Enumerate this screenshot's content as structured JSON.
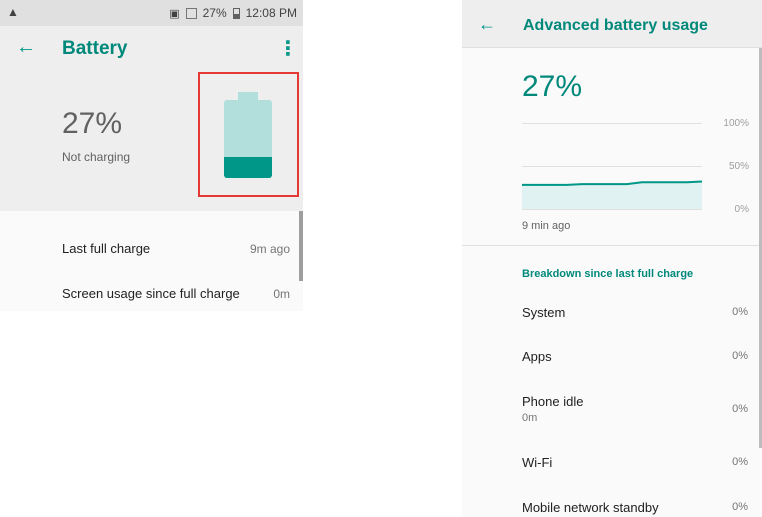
{
  "left_screen": {
    "status_bar": {
      "battery_percent": "27%",
      "time": "12:08 PM"
    },
    "app_bar": {
      "title": "Battery",
      "icons": [
        "back-arrow-icon",
        "more-vert-icon"
      ]
    },
    "summary": {
      "percent": "27%",
      "state": "Not charging",
      "battery_level_fraction": 0.27,
      "accent_color": "#009688",
      "highlight_color": "#e53935"
    },
    "list": [
      {
        "label": "Last full charge",
        "value": "9m ago"
      },
      {
        "label": "Screen usage since full charge",
        "value": "0m"
      }
    ]
  },
  "right_screen": {
    "app_bar": {
      "title": "Advanced battery usage"
    },
    "percent": "27%",
    "chart_data": {
      "type": "line",
      "y_ticks": [
        "100%",
        "50%",
        "0%"
      ],
      "ylim": [
        0,
        100
      ],
      "x_label_start": "9 min ago",
      "series": [
        {
          "values": [
            28,
            28,
            28,
            28,
            29,
            29,
            29,
            29,
            31,
            31,
            31,
            31,
            32
          ]
        }
      ],
      "line_color": "#009688",
      "fill_color": "#e0f2f1",
      "grid": true
    },
    "section_title": "Breakdown since last full charge",
    "breakdown": [
      {
        "label": "System",
        "sub": "",
        "value": "0%"
      },
      {
        "label": "Apps",
        "sub": "",
        "value": "0%"
      },
      {
        "label": "Phone idle",
        "sub": "0m",
        "value": "0%"
      },
      {
        "label": "Wi-Fi",
        "sub": "",
        "value": "0%"
      },
      {
        "label": "Mobile network standby",
        "sub": "",
        "value": "0%"
      }
    ]
  }
}
